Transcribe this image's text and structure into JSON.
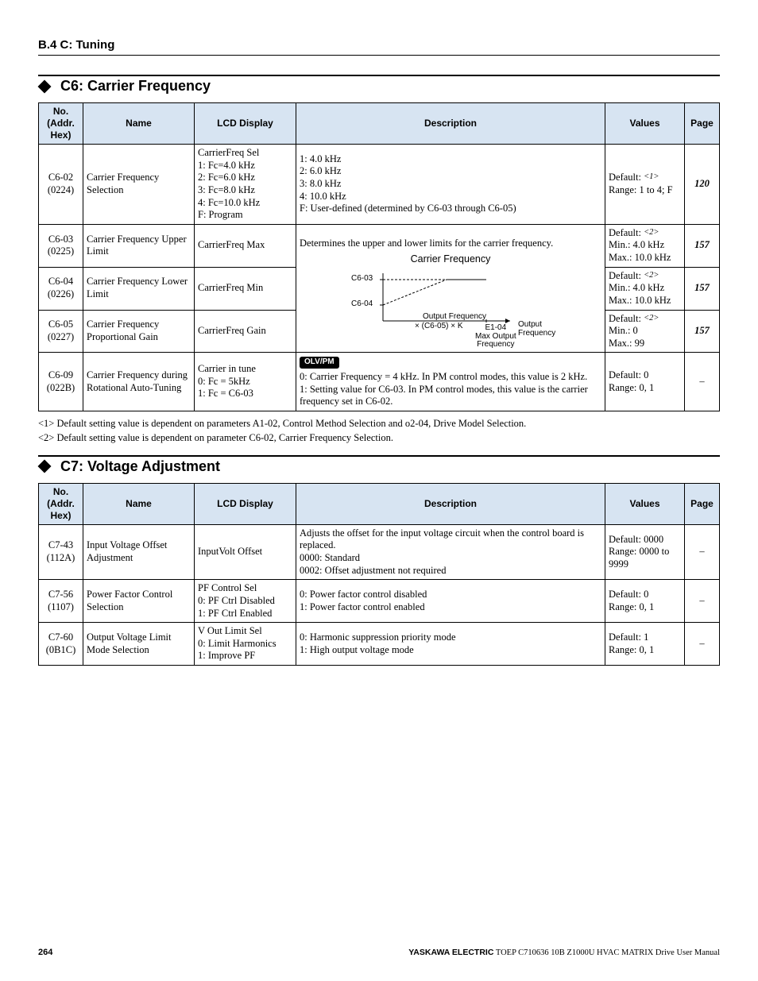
{
  "breadcrumb": "B.4 C: Tuning",
  "headers": [
    "No.\n(Addr.\nHex)",
    "Name",
    "LCD Display",
    "Description",
    "Values",
    "Page"
  ],
  "sections": [
    {
      "title": "C6: Carrier Frequency",
      "rows": [
        {
          "no": "C6-02\n(0224)",
          "name": "Carrier Frequency Selection",
          "lcd": "CarrierFreq Sel\n1: Fc=4.0 kHz\n2: Fc=6.0 kHz\n3: Fc=8.0 kHz\n4: Fc=10.0 kHz\nF: Program",
          "desc_plain": "1: 4.0 kHz\n2: 6.0 kHz\n3: 8.0 kHz\n4: 10.0 kHz\nF: User-defined (determined by C6-03 through C6-05)",
          "values_pre": "Default: ",
          "values_sup": "<1>",
          "values_post": "\nRange: 1 to 4; F",
          "page": "120"
        },
        {
          "no": "C6-03\n(0225)",
          "name": "Carrier Frequency Upper Limit",
          "lcd": "CarrierFreq Max",
          "values_pre": "Default: ",
          "values_sup": "<2>",
          "values_post": "\nMin.: 4.0 kHz\nMax.: 10.0 kHz",
          "page": "157"
        },
        {
          "no": "C6-04\n(0226)",
          "name": "Carrier Frequency Lower Limit",
          "lcd": "CarrierFreq Min",
          "values_pre": "Default: ",
          "values_sup": "<2>",
          "values_post": "\nMin.: 4.0 kHz\nMax.: 10.0 kHz",
          "page": "157"
        },
        {
          "no": "C6-05\n(0227)",
          "name": "Carrier Frequency Proportional Gain",
          "lcd": "CarrierFreq Gain",
          "values_pre": "Default: ",
          "values_sup": "<2>",
          "values_post": "\nMin.: 0\nMax.: 99",
          "page": "157"
        },
        {
          "no": "C6-09\n(022B)",
          "name": "Carrier Frequency during Rotational Auto-Tuning",
          "lcd": "Carrier in tune\n0: Fc = 5kHz\n1: Fc = C6-03",
          "desc_pill": "OLV/PM",
          "desc_plain": "0: Carrier Frequency = 4 kHz. In PM control modes, this value is 2 kHz.\n1: Setting value for C6-03. In PM control modes, this value is the carrier frequency set in C6-02.",
          "values_pre": "Default: 0\nRange: 0, 1",
          "values_sup": "",
          "values_post": "",
          "page": "–"
        }
      ],
      "diagram": {
        "top_text": "Determines the upper and lower limits for the carrier frequency.",
        "y_axis": "Carrier Frequency",
        "c603": "C6-03",
        "c604": "C6-04",
        "x_axis": "Output Frequency",
        "gain": "× (C6-05) × K",
        "e104": "E1-04\nMax Output\nFrequency",
        "outfreq": "Output\nFrequency"
      },
      "footnotes": [
        "<1>   Default setting value is dependent on parameters A1-02, Control Method Selection and o2-04, Drive Model Selection.",
        "<2>   Default setting value is dependent on parameter C6-02, Carrier Frequency Selection."
      ]
    },
    {
      "title": "C7: Voltage Adjustment",
      "rows": [
        {
          "no": "C7-43\n(112A)",
          "name": "Input Voltage Offset Adjustment",
          "lcd": "InputVolt Offset",
          "desc_plain": "Adjusts the offset for the input voltage circuit when the control board is replaced.\n0000: Standard\n0002: Offset adjustment not required",
          "values_pre": "Default: 0000\nRange: 0000 to 9999",
          "values_sup": "",
          "values_post": "",
          "page": "–"
        },
        {
          "no": "C7-56\n(1107)",
          "name": "Power Factor Control Selection",
          "lcd": "PF Control Sel\n0: PF Ctrl Disabled\n1: PF Ctrl Enabled",
          "desc_plain": "0: Power factor control disabled\n1: Power factor control enabled",
          "values_pre": "Default: 0\nRange: 0, 1",
          "values_sup": "",
          "values_post": "",
          "page": "–"
        },
        {
          "no": "C7-60\n(0B1C)",
          "name": "Output Voltage Limit Mode Selection",
          "lcd": "V Out Limit Sel\n0: Limit Harmonics\n1: Improve PF",
          "desc_plain": "0: Harmonic suppression priority mode\n1: High output voltage mode",
          "values_pre": "Default: 1\nRange: 0, 1",
          "values_sup": "",
          "values_post": "",
          "page": "–"
        }
      ]
    }
  ],
  "footer": {
    "page_num": "264",
    "manual_bold": "YASKAWA ELECTRIC",
    "manual_rest": " TOEP C710636 10B Z1000U HVAC MATRIX Drive User Manual"
  }
}
